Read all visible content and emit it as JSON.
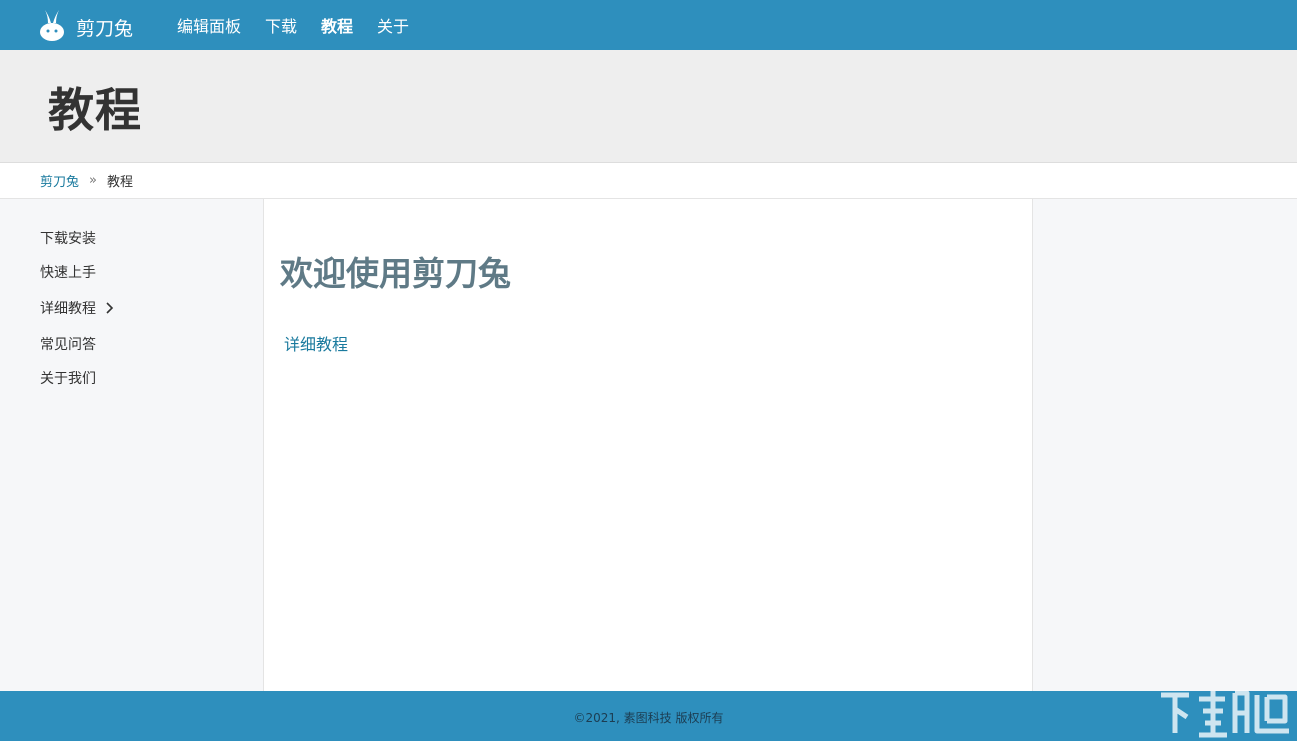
{
  "header": {
    "brand_name": "剪刀兔",
    "nav": [
      {
        "label": "编辑面板",
        "active": false
      },
      {
        "label": "下载",
        "active": false
      },
      {
        "label": "教程",
        "active": true
      },
      {
        "label": "关于",
        "active": false
      }
    ]
  },
  "hero": {
    "title": "教程"
  },
  "breadcrumb": {
    "home": "剪刀兔",
    "separator": "»",
    "current": "教程"
  },
  "sidebar": {
    "items": [
      {
        "label": "下载安装"
      },
      {
        "label": "快速上手"
      },
      {
        "label": "详细教程",
        "has_children": true
      },
      {
        "label": "常见问答"
      },
      {
        "label": "关于我们"
      }
    ]
  },
  "main": {
    "title": "欢迎使用剪刀兔",
    "link": "详细教程"
  },
  "footer": {
    "copyright": "©2021, 素图科技 版权所有"
  },
  "colors": {
    "header_bg": "#2e8fbd",
    "hero_bg": "#eeeeee",
    "link": "#1a7a9e",
    "sidebar_bg": "#f6f7f9",
    "main_title": "#5f7a86"
  },
  "icons": {
    "logo": "rabbit-logo-icon",
    "expand": "chevron-right-icon",
    "watermark": "xiazaiba-watermark-logo"
  }
}
